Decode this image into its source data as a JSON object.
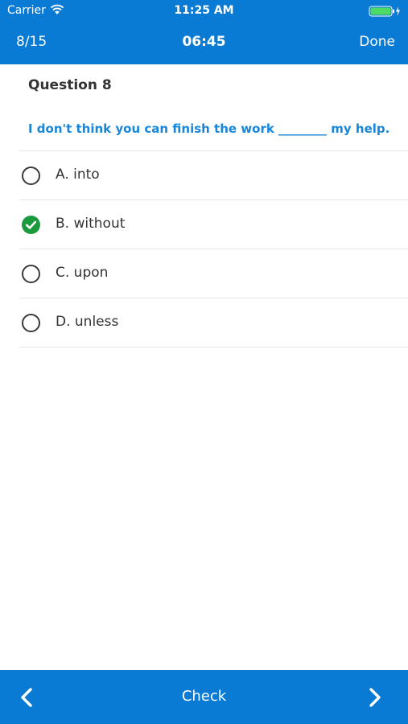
{
  "status_bar": {
    "carrier": "Carrier",
    "time": "11:25 AM",
    "wifi_icon": "wifi-icon",
    "battery_icon": "battery-charging-icon",
    "battery_color": "#4cd964"
  },
  "nav_bar": {
    "progress": "8/15",
    "timer": "06:45",
    "done_label": "Done",
    "background_color": "#0a7bd4"
  },
  "question": {
    "title": "Question 8",
    "text": "I don't think you can finish the work ________ my help.",
    "text_color": "#1a86d8"
  },
  "options": [
    {
      "label": "A. into",
      "selected": false
    },
    {
      "label": "B. without",
      "selected": true
    },
    {
      "label": "C. upon",
      "selected": false
    },
    {
      "label": "D. unless",
      "selected": false
    }
  ],
  "selected_color": "#1a9a3c",
  "footer": {
    "prev_icon": "chevron-left-icon",
    "check_label": "Check",
    "next_icon": "chevron-right-icon"
  }
}
